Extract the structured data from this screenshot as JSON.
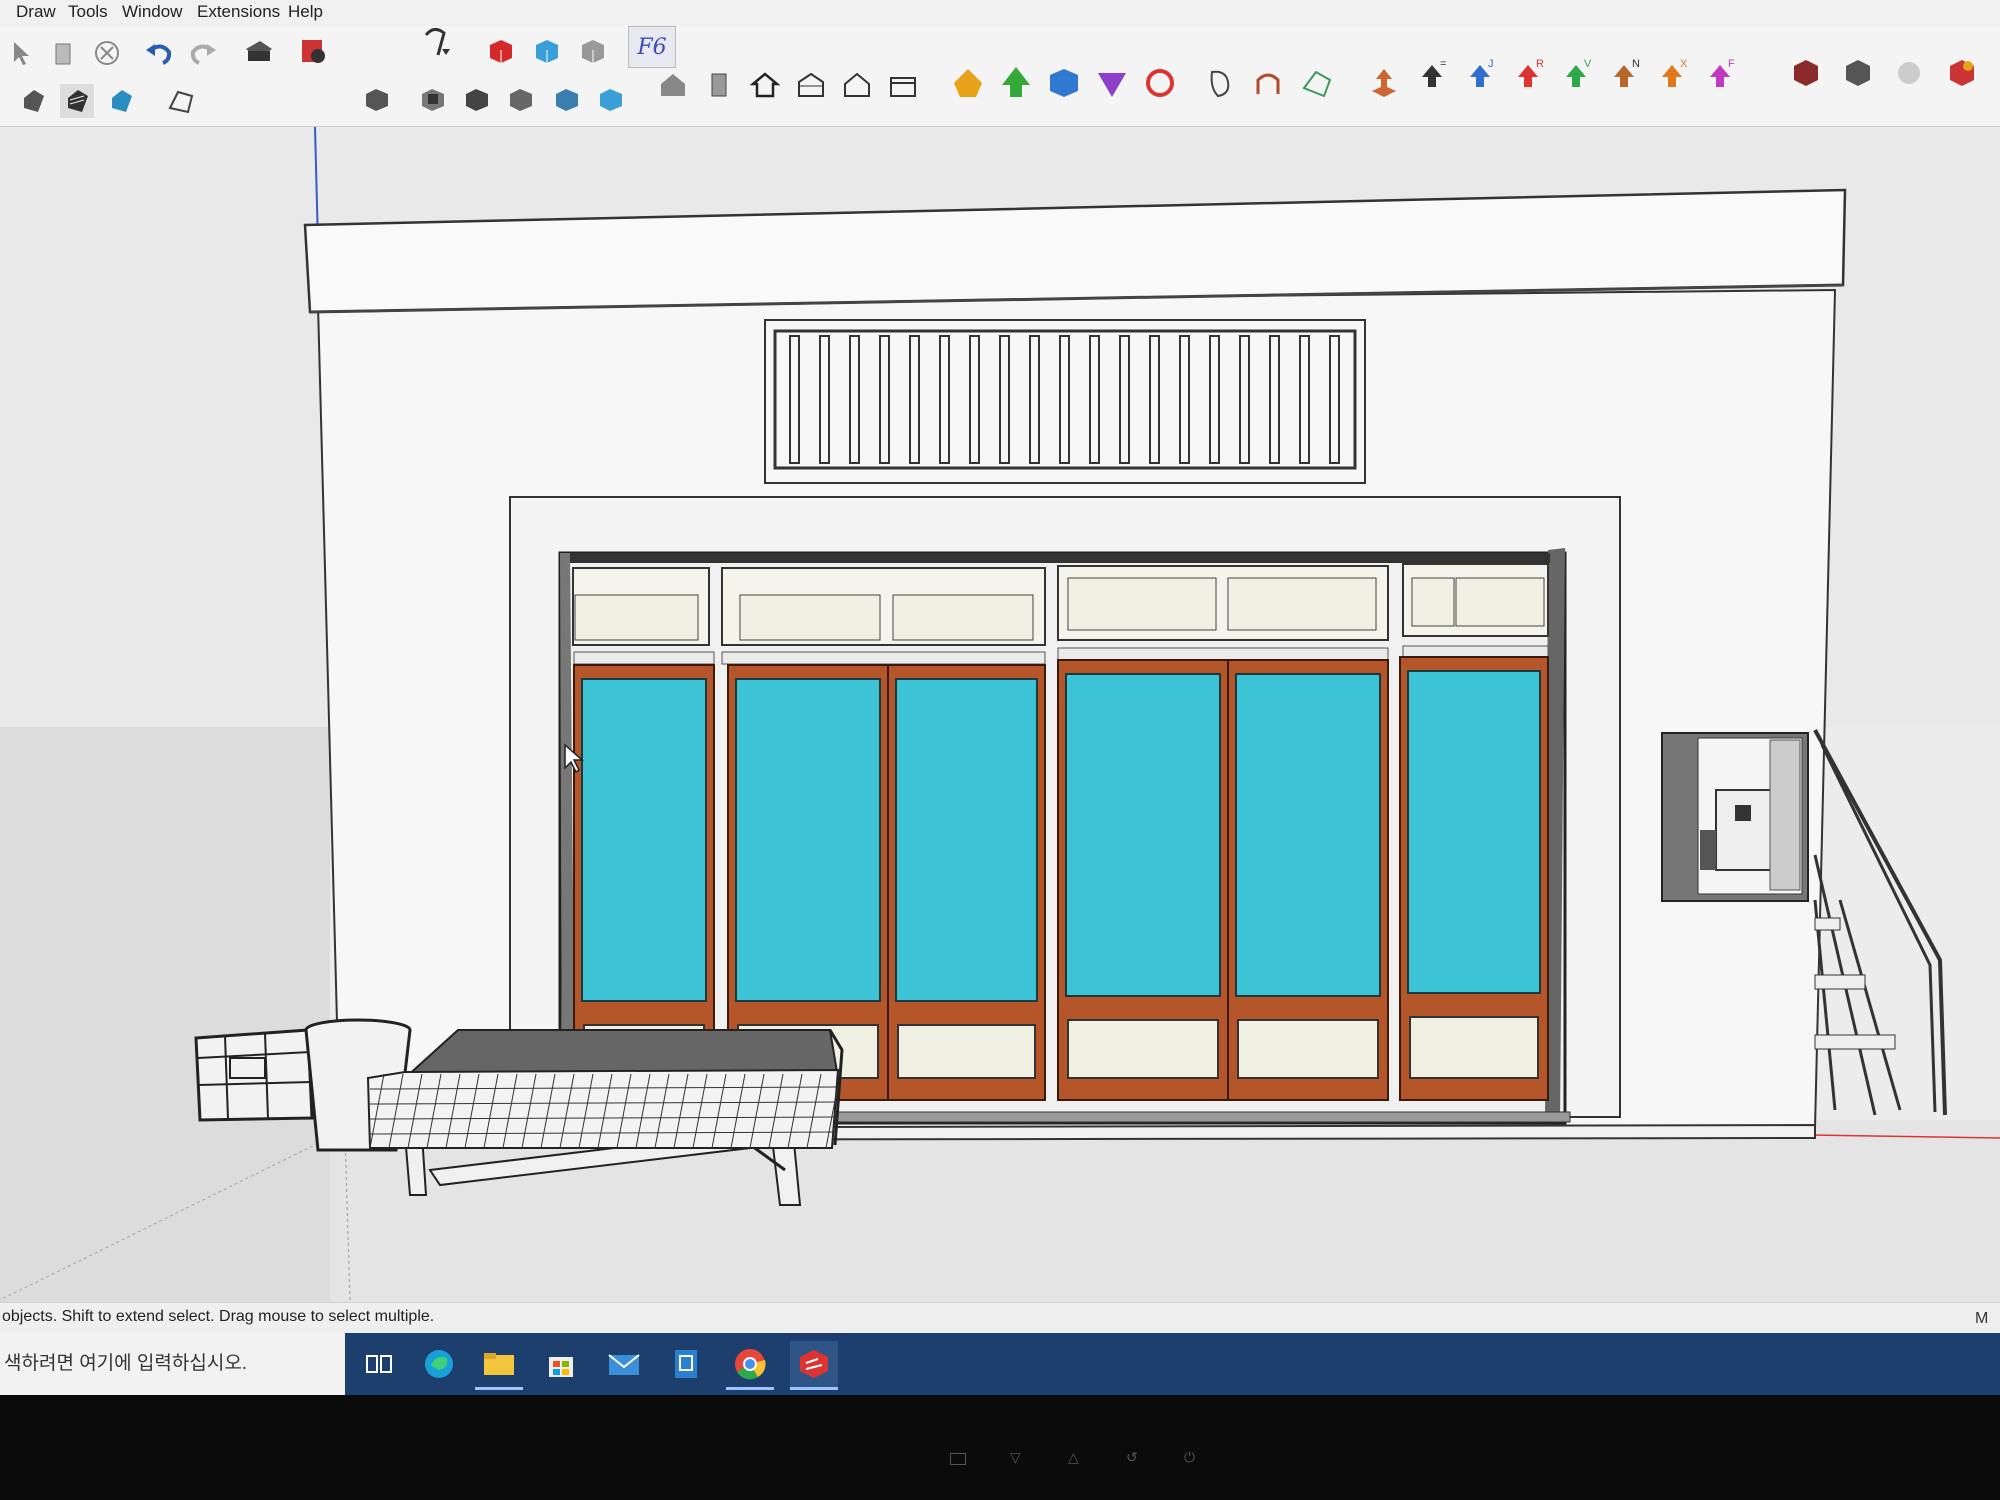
{
  "menu": [
    "Draw",
    "Tools",
    "Window",
    "Extensions",
    "Help"
  ],
  "toolbar": {
    "tool_badge": "F6",
    "arrow_badges": [
      "=",
      "J",
      "R",
      "V",
      "N",
      "X",
      "F"
    ]
  },
  "icons": [
    "select-icon",
    "eraser-icon",
    "delete-icon",
    "undo-icon",
    "redo-icon",
    "print-icon",
    "model-info-icon",
    "styles-icon",
    "red-box-icon",
    "blue-box-icon",
    "gray-box-icon",
    "f6-tool-icon",
    "shaded-style-icon",
    "xray-style-icon",
    "monochrome-style-icon",
    "section-plane-icon",
    "iso-view-icon",
    "top-view-icon",
    "front-view-icon",
    "right-view-icon",
    "back-view-icon",
    "left-view-icon",
    "warehouse-icon",
    "component-icon",
    "home-view-icon",
    "house-side-icon",
    "house-outline-icon",
    "bottom-view-icon",
    "solid-tool-icons",
    "sandbox-icons",
    "extension-arrow-icons",
    "render-icons"
  ],
  "colors": {
    "glass": "#3cc3d6",
    "frame_wood": "#b5562a",
    "panel_cream": "#f1f1e3",
    "axis_blue": "#3b58c8",
    "axis_red": "#d33"
  },
  "status": {
    "hint": "objects. Shift to extend select. Drag mouse to select multiple.",
    "right_label": "M"
  },
  "taskbar": {
    "search_placeholder": "색하려면 여기에 입력하십시오.",
    "apps": [
      "task-view",
      "edge",
      "file-explorer",
      "store",
      "mail",
      "app-installer",
      "chrome",
      "sketchup"
    ]
  }
}
